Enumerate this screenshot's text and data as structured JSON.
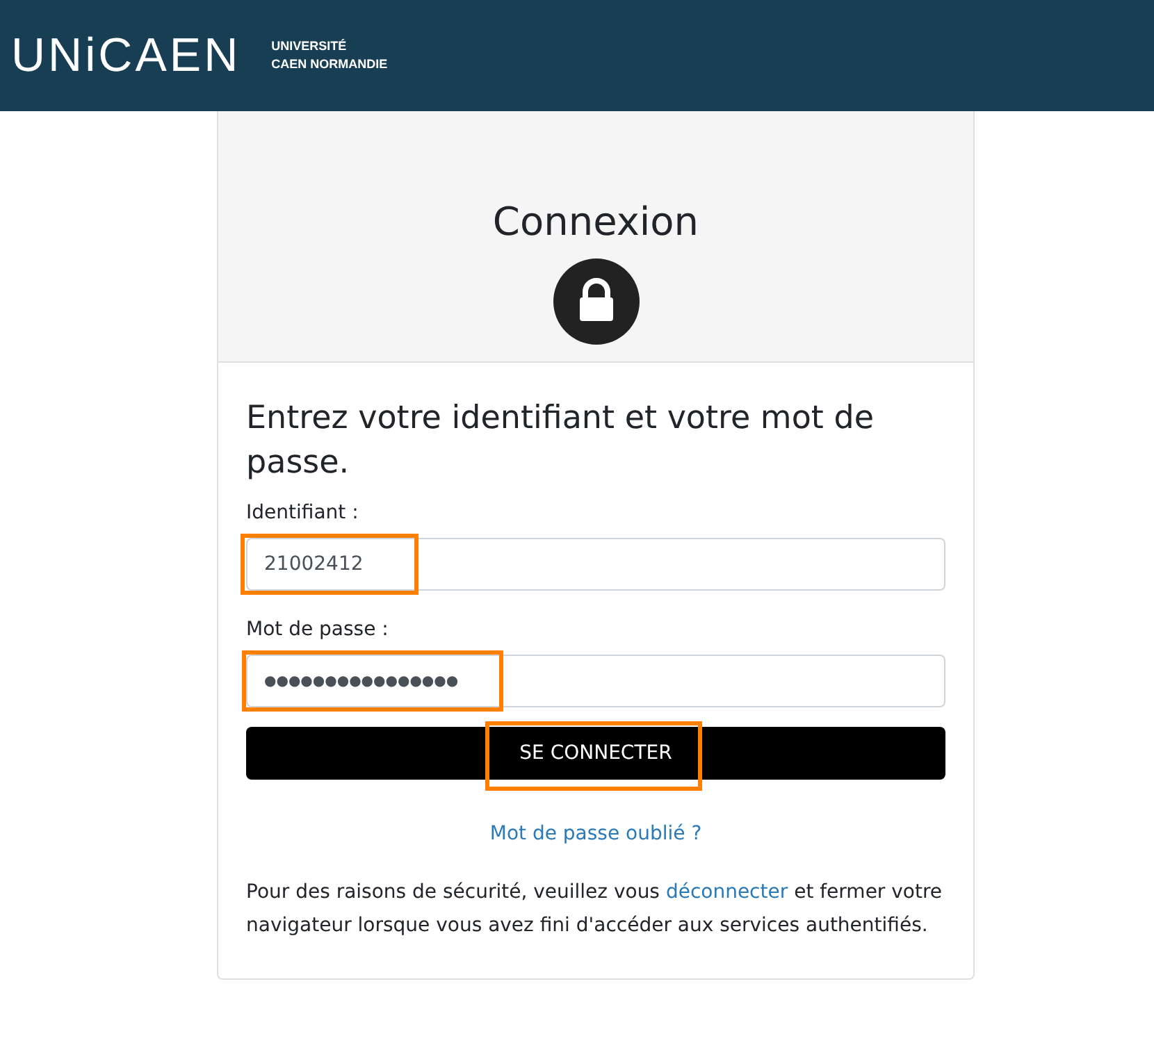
{
  "header": {
    "logo": "UNiCAEN",
    "university_line_1": "UNIVERSITÉ",
    "university_line_2": "CAEN NORMANDIE"
  },
  "card": {
    "title": "Connexion",
    "instructions": "Entrez votre identifiant et votre mot de passe.",
    "fields": [
      {
        "label": "Identifiant :",
        "value": "21002412",
        "highlighted": true
      },
      {
        "label": "Mot de passe :",
        "value": "●●●●●●●●●●●●●●●●",
        "highlighted": true
      }
    ],
    "submit": {
      "label": "SE CONNECTER",
      "highlighted": true
    },
    "forgot_link": "Mot de passe oublié ?",
    "notice": {
      "before": "Pour des raisons de sécurité, veuillez vous ",
      "link": "déconnecter",
      "after": " et fermer votre navigateur lorsque vous avez fini d'accéder aux services authentifiés."
    }
  }
}
